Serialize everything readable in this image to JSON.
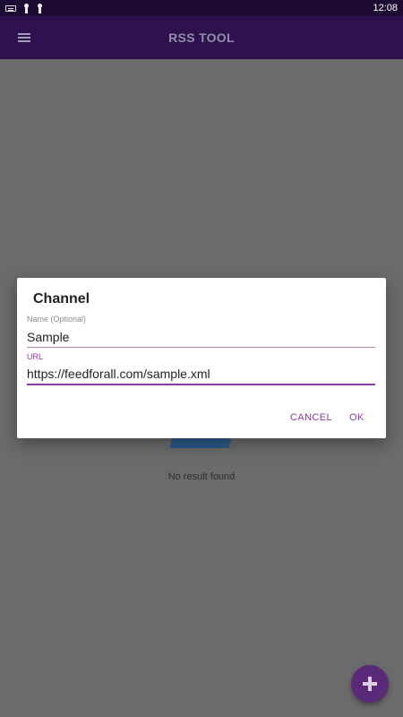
{
  "status_bar": {
    "time": "12:08",
    "icons": [
      "keyboard-icon",
      "key-icon",
      "key-icon"
    ]
  },
  "app_bar": {
    "title": "RSS TOOL",
    "menu_icon": "menu-icon"
  },
  "empty_state": {
    "message": "No result found"
  },
  "dialog": {
    "title": "Channel",
    "name_field": {
      "label": "Name (Optional)",
      "value": "Sample"
    },
    "url_field": {
      "label": "URL",
      "value": "https://feedforall.com/sample.xml"
    },
    "cancel_label": "CANCEL",
    "ok_label": "OK"
  },
  "fab": {
    "icon": "plus-icon"
  },
  "colors": {
    "status_bar": "#1e0b33",
    "app_bar": "#2f1150",
    "scrim": "#6b6b6b",
    "accent": "#8e3aa0",
    "fab": "#5a2a78"
  }
}
